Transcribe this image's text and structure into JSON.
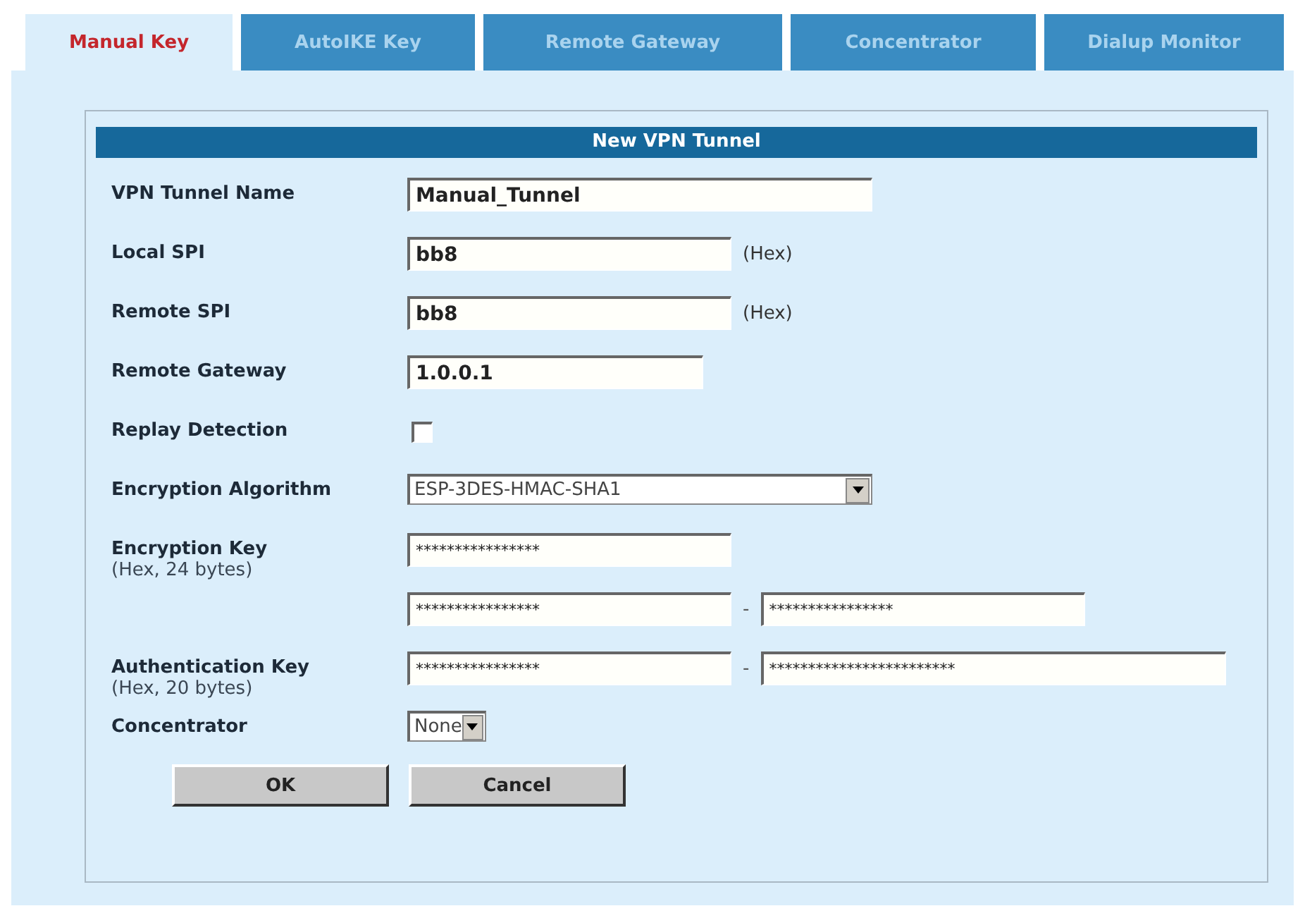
{
  "tabs": [
    {
      "label": "Manual Key",
      "selected": true
    },
    {
      "label": "AutoIKE Key",
      "selected": false
    },
    {
      "label": "Remote Gateway",
      "selected": false
    },
    {
      "label": "Concentrator",
      "selected": false
    },
    {
      "label": "Dialup Monitor",
      "selected": false
    }
  ],
  "form": {
    "title": "New VPN Tunnel",
    "rows": [
      {
        "kind": "text",
        "label": "VPN Tunnel Name",
        "inputs": [
          "Manual_Tunnel"
        ]
      },
      {
        "kind": "text",
        "label": "Local SPI",
        "inputs": [
          "bb8"
        ],
        "suffix": "(Hex)"
      },
      {
        "kind": "text",
        "label": "Remote SPI",
        "inputs": [
          "bb8"
        ],
        "suffix": "(Hex)"
      },
      {
        "kind": "text",
        "label": "Remote Gateway",
        "inputs": [
          "1.0.0.1"
        ]
      },
      {
        "kind": "checkbox",
        "label": "Replay Detection",
        "checked": false
      },
      {
        "kind": "select",
        "label": "Encryption Algorithm",
        "value": "ESP-3DES-HMAC-SHA1"
      },
      {
        "kind": "password",
        "label": "Encryption Key",
        "sublabel": "(Hex, 24 bytes)",
        "inputs": [
          "****************"
        ]
      },
      {
        "kind": "password",
        "inputs": [
          "****************",
          "****************"
        ],
        "separator": "-"
      },
      {
        "kind": "password",
        "label": "Authentication Key",
        "sublabel": "(Hex, 20 bytes)",
        "inputs": [
          "****************",
          "************************"
        ],
        "separator": "-"
      },
      {
        "kind": "select",
        "label": "Concentrator",
        "value": "None"
      }
    ],
    "buttons": [
      "OK",
      "Cancel"
    ]
  }
}
